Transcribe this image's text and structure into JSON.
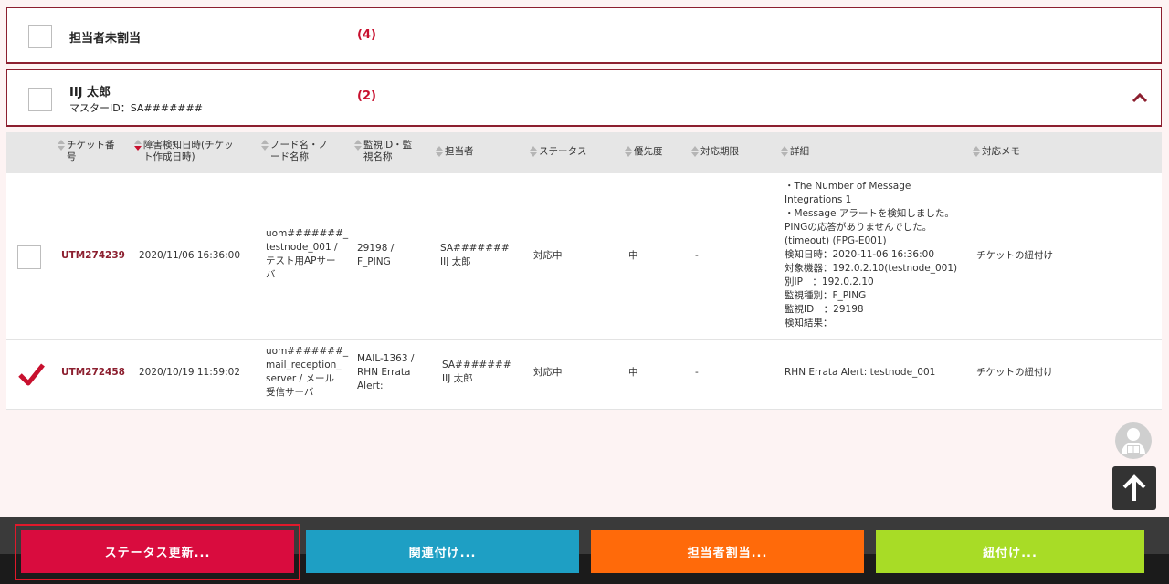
{
  "groups": [
    {
      "name": "担当者未割当",
      "count": "(4)"
    },
    {
      "name": "IIJ 太郎",
      "sub": "マスターID：SA#######",
      "count": "(2)"
    }
  ],
  "table": {
    "headers": [
      {
        "label": "チケット番号",
        "line1": "チケット番",
        "line2": "号"
      },
      {
        "label": "障害検知日時(チケット作成日時)",
        "line1": "障害検知日時(チケッ",
        "line2": "ト作成日時)"
      },
      {
        "label": "ノード名・ノード名称",
        "line1": "ノード名・ノ",
        "line2": "ード名称"
      },
      {
        "label": "監視ID・監視名称",
        "line1": "監視ID・監",
        "line2": "視名称"
      },
      {
        "label": "担当者"
      },
      {
        "label": "ステータス"
      },
      {
        "label": "優先度"
      },
      {
        "label": "対応期限"
      },
      {
        "label": "詳細"
      },
      {
        "label": "対応メモ"
      }
    ],
    "rows": [
      {
        "checked": false,
        "ticket": "UTM274239",
        "datetime": "2020/11/06 16:36:00",
        "node": [
          "uom#######_",
          "testnode_001 /",
          "テスト用APサー",
          "バ"
        ],
        "monitor": [
          "29198 /",
          "F_PING"
        ],
        "assignee": [
          "SA#######",
          "IIJ 太郎"
        ],
        "status": "対応中",
        "priority": "中",
        "deadline": "-",
        "detail": [
          "・The Number of Message",
          "Integrations 1",
          "・Message アラートを検知しました。",
          "PINGの応答がありませんでした。",
          "(timeout) (FPG-E001)",
          "検知日時：2020-11-06 16:36:00",
          "対象機器：192.0.2.10(testnode_001)",
          "別IP　：192.0.2.10",
          "監視種別：F_PING",
          "監視ID　：29198",
          "検知結果："
        ],
        "memo": "チケットの紐付け"
      },
      {
        "checked": true,
        "ticket": "UTM272458",
        "datetime": "2020/10/19 11:59:02",
        "node": [
          "uom#######_",
          "mail_reception_",
          "server / メール",
          "受信サーバ"
        ],
        "monitor": [
          "MAIL-1363 /",
          "RHN Errata",
          "Alert:"
        ],
        "assignee": [
          "SA#######",
          "IIJ 太郎"
        ],
        "status": "対応中",
        "priority": "中",
        "deadline": "-",
        "detail": [
          "RHN Errata Alert: testnode_001"
        ],
        "memo": "チケットの紐付け"
      }
    ]
  },
  "footer": {
    "status_btn": "ステータス更新...",
    "relate_btn": "関連付け...",
    "assign_btn": "担当者割当...",
    "link_btn": "紐付け..."
  },
  "colors": {
    "accent": "#8c1f2f",
    "status_btn": "#d90c3e",
    "relate_btn": "#1e9fc4",
    "assign_btn": "#ff6a0a",
    "link_btn": "#a8dc26"
  },
  "icons": {
    "caret": "chevron-up-icon",
    "user": "user-icon",
    "top": "arrow-up-icon",
    "checked": "checkmark-icon"
  }
}
